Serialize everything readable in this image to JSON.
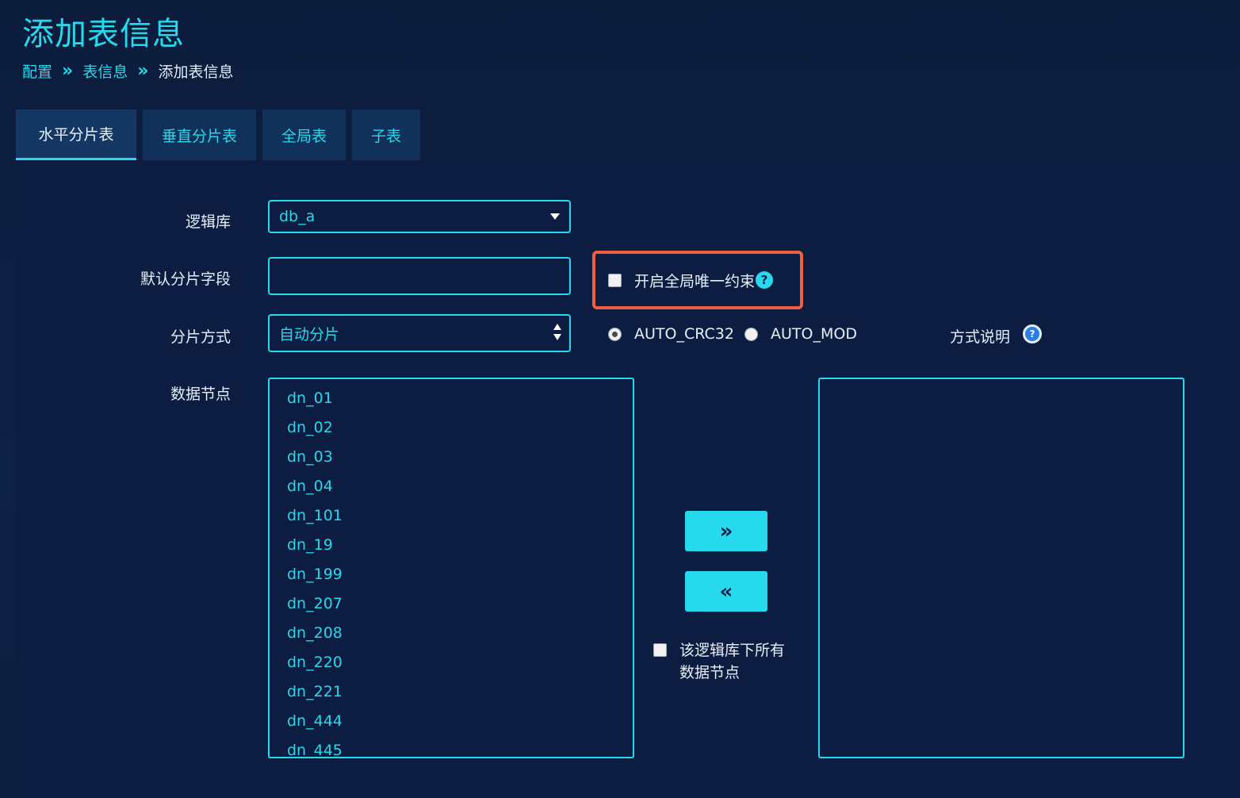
{
  "page": {
    "title": "添加表信息",
    "breadcrumb": {
      "items": [
        "配置",
        "表信息",
        "添加表信息"
      ]
    }
  },
  "tabs": [
    {
      "label": "水平分片表",
      "active": true
    },
    {
      "label": "垂直分片表",
      "active": false
    },
    {
      "label": "全局表",
      "active": false
    },
    {
      "label": "子表",
      "active": false
    }
  ],
  "form": {
    "logic_db": {
      "label": "逻辑库",
      "value": "db_a"
    },
    "default_shard_field": {
      "label": "默认分片字段",
      "value": ""
    },
    "global_unique": {
      "label": "开启全局唯一约束",
      "checked": false,
      "help_icon": "question-circle-icon"
    },
    "shard_method": {
      "label": "分片方式",
      "value": "自动分片",
      "radios": [
        {
          "label": "AUTO_CRC32",
          "checked": true
        },
        {
          "label": "AUTO_MOD",
          "checked": false
        }
      ],
      "method_desc_label": "方式说明",
      "method_help_icon": "info-circle-icon"
    },
    "data_nodes": {
      "label": "数据节点",
      "available": [
        "dn_01",
        "dn_02",
        "dn_03",
        "dn_04",
        "dn_101",
        "dn_19",
        "dn_199",
        "dn_207",
        "dn_208",
        "dn_220",
        "dn_221",
        "dn_444",
        "dn_445"
      ],
      "selected": [],
      "add_button_icon": "double-chevron-right-icon",
      "remove_button_icon": "double-chevron-left-icon",
      "all_nodes_label": "该逻辑库下所有数据节点",
      "all_nodes_checked": false
    }
  },
  "colors": {
    "accent": "#27d9ec",
    "highlight_border": "#f0603d",
    "background": "#0c1d41",
    "text": "#e6eef6"
  }
}
